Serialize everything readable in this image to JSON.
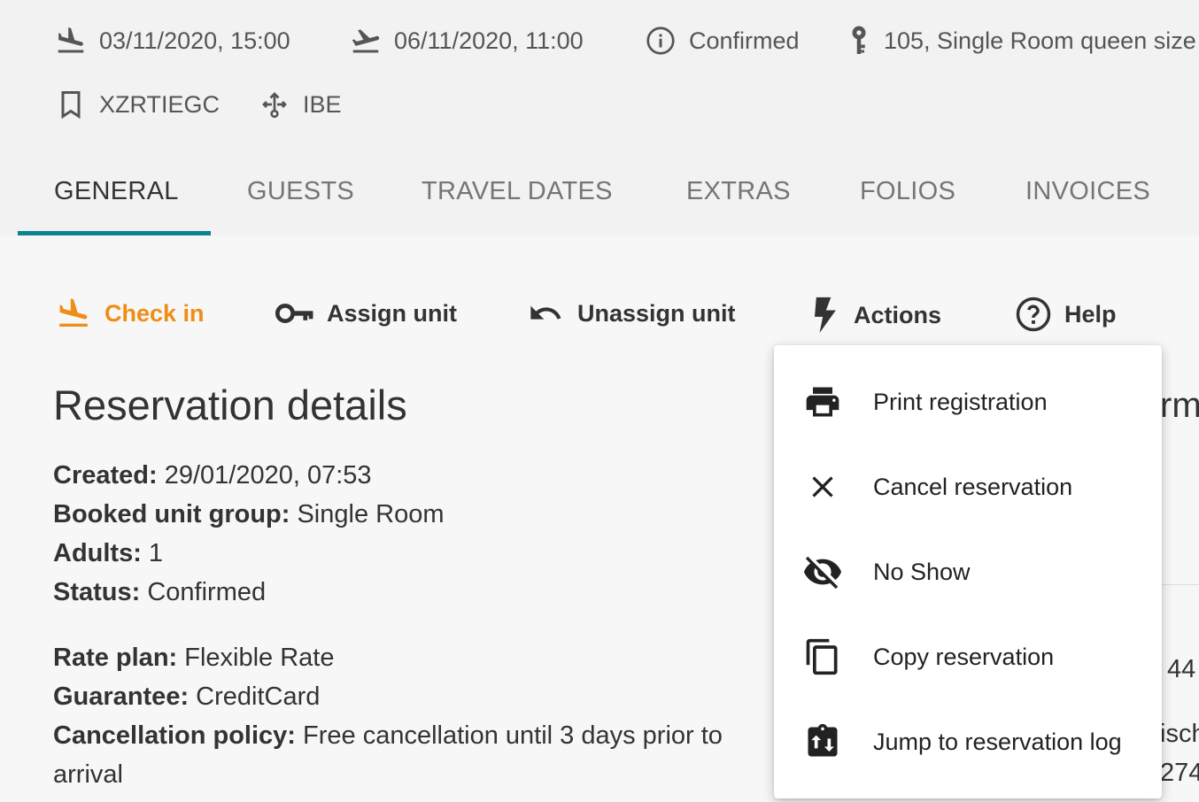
{
  "header": {
    "arrival": "03/11/2020, 15:00",
    "departure": "06/11/2020, 11:00",
    "status": "Confirmed",
    "unit": "105,  Single Room queen size",
    "booking_id": "XZRTIEGC",
    "channel": "IBE"
  },
  "tabs": [
    {
      "label": "GENERAL",
      "active": true
    },
    {
      "label": "GUESTS"
    },
    {
      "label": "TRAVEL DATES"
    },
    {
      "label": "EXTRAS"
    },
    {
      "label": "FOLIOS"
    },
    {
      "label": "INVOICES"
    }
  ],
  "actions": {
    "check_in": "Check in",
    "assign_unit": "Assign unit",
    "unassign_unit": "Unassign unit",
    "actions": "Actions",
    "help": "Help"
  },
  "details": {
    "title": "Reservation details",
    "created_label": "Created:",
    "created_value": " 29/01/2020, 07:53",
    "unit_group_label": "Booked unit group:",
    "unit_group_value": " Single Room",
    "adults_label": "Adults:",
    "adults_value": " 1",
    "status_label": "Status:",
    "status_value": " Confirmed",
    "rate_plan_label": "Rate plan:",
    "rate_plan_value": " Flexible Rate",
    "guarantee_label": "Guarantee:",
    "guarantee_value": " CreditCard",
    "cancellation_label": "Cancellation policy:",
    "cancellation_value": " Free cancellation until 3 days prior to",
    "cancellation_value_2": "arrival"
  },
  "right_column": {
    "heading_fragment": "rm",
    "line1": "44",
    "line2": "isch",
    "line3": "274"
  },
  "actions_menu": {
    "items": [
      {
        "label": "Print registration",
        "icon": "print-icon"
      },
      {
        "label": "Cancel reservation",
        "icon": "close-icon"
      },
      {
        "label": "No Show",
        "icon": "eye-off-icon"
      },
      {
        "label": "Copy reservation",
        "icon": "copy-icon"
      },
      {
        "label": "Jump to reservation log",
        "icon": "log-icon"
      }
    ]
  },
  "colors": {
    "accent": "#ef8d15",
    "tab_underline": "#0f8290",
    "text": "#333333",
    "muted": "#757575"
  }
}
